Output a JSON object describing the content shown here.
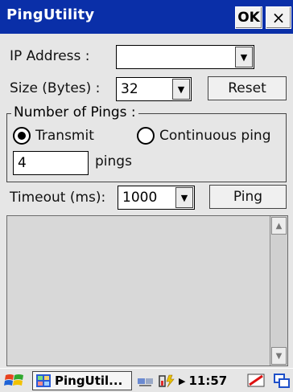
{
  "app": {
    "title": "PingUtility",
    "ok_label": "OK",
    "close_label": "×"
  },
  "form": {
    "ip_label": "IP Address :",
    "ip_value": "",
    "size_label": "Size (Bytes) :",
    "size_value": "32",
    "reset_label": "Reset",
    "group_label": "Number of Pings :",
    "transmit_label": "Transmit",
    "continuous_label": "Continuous ping",
    "selected_mode": "Transmit",
    "pings_value": "4",
    "pings_unit": "pings",
    "timeout_label": "Timeout (ms):",
    "timeout_value": "1000",
    "ping_label": "Ping"
  },
  "taskbar": {
    "task_label": "PingUtil...",
    "clock": "11:57"
  },
  "colors": {
    "title_bar": "#0a2fa8",
    "background": "#e6e6e6"
  }
}
